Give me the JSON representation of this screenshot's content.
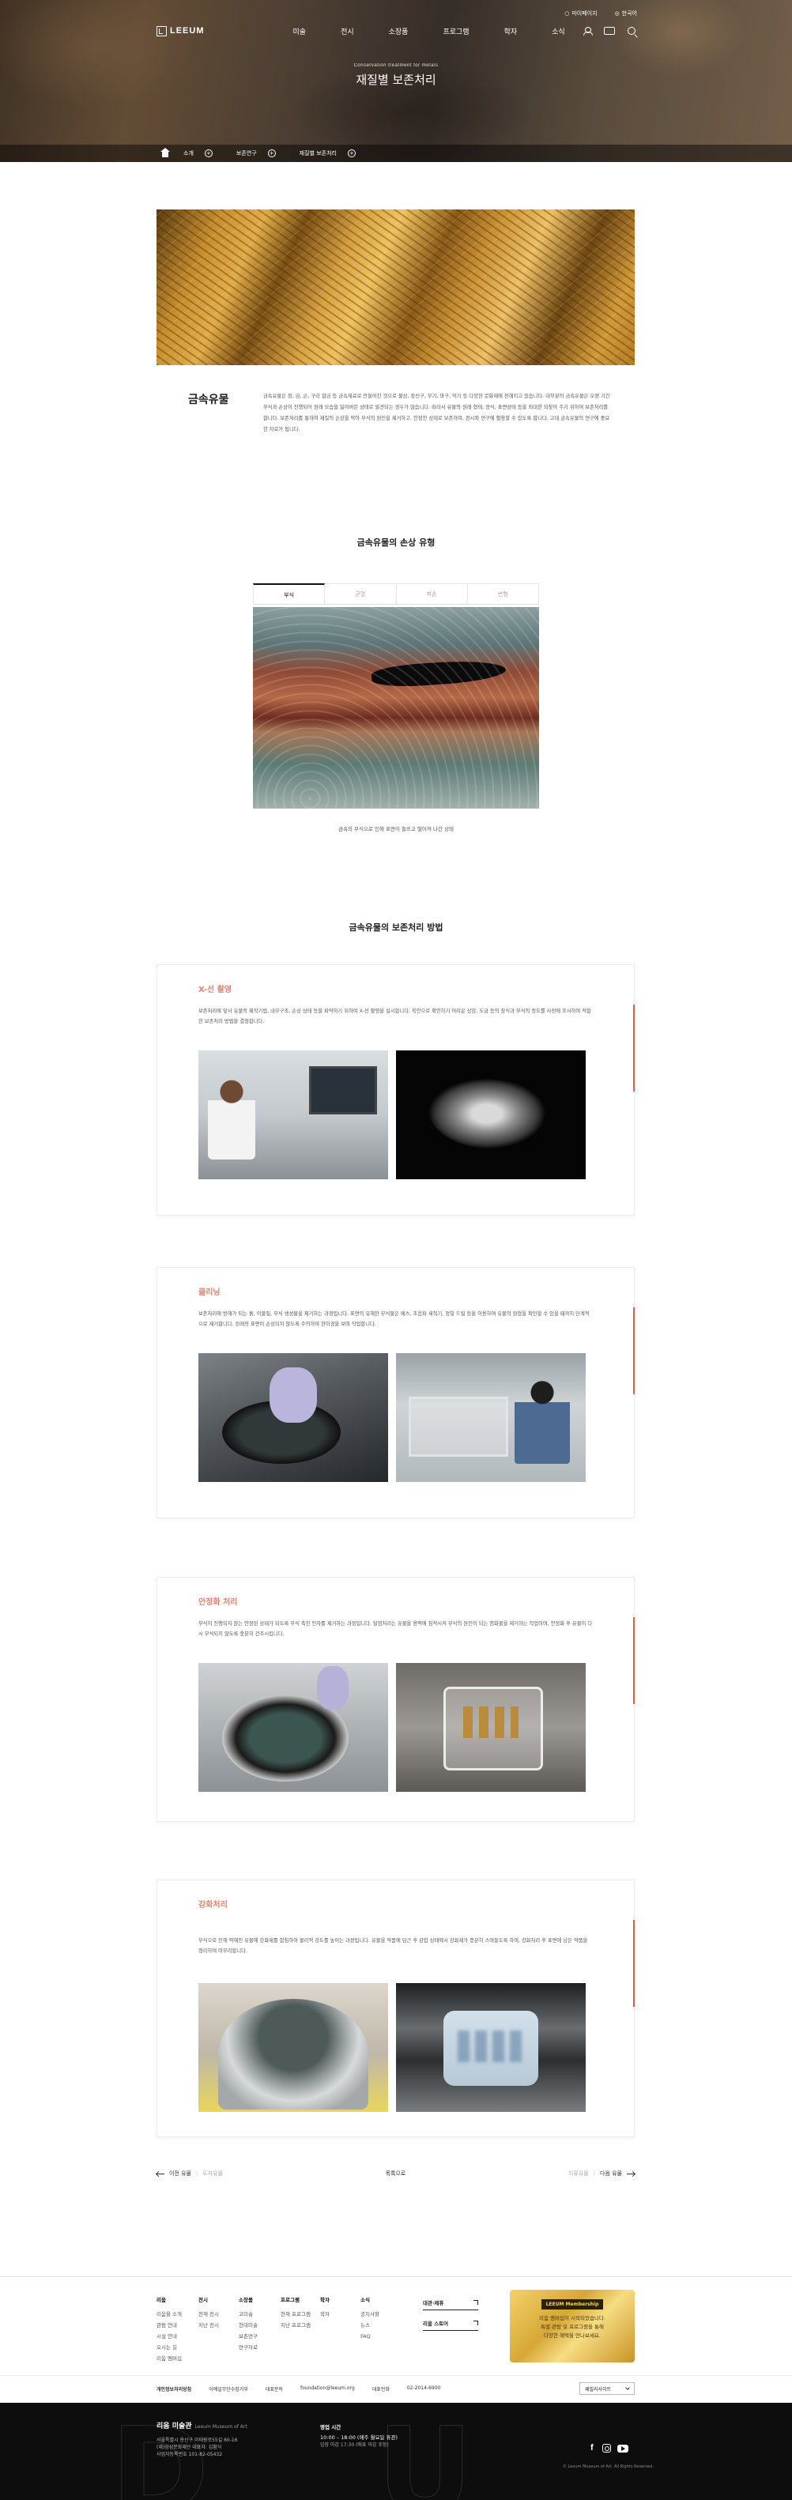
{
  "header": {
    "utility": {
      "login": "마이페이지",
      "lang": "한국어"
    },
    "logo": "LEEUM",
    "menu": [
      "미술",
      "전시",
      "소장품",
      "프로그램",
      "학자",
      "소식"
    ],
    "hero_subtitle": "Conservation treatment for metals",
    "hero_title": "재질별 보존처리",
    "breadcrumbs": [
      "소개",
      "보존연구",
      "재질별 보존처리"
    ]
  },
  "intro": {
    "title": "금속유물",
    "text": "금속유물은 청, 금, 은, 구리 합금 등 금속재료로 만들어진 것으로 불상, 장신구, 무기, 마구, 악기 등 다양한 문화재에 전해지고 있습니다. 대부분의 금속유물은 오랜 기간 부식과 손상이 진행되어 원래 모습을 잃어버린 상태로 발견되는 경우가 많습니다. 따라서 유물의 원래 형태, 장식, 표면상태 등을 최대한 되찾아 주기 위하여 보존처리를 합니다. 보존처리를 통하여 재질의 손상을 막아 부식의 원인을 제거하고, 안정한 상태로 보존하며, 전시와 연구에 활용할 수 있도록 합니다. 고대 금속유물의 연구에 중요한 자료가 됩니다."
  },
  "damage": {
    "title": "금속유물의 손상 유형",
    "tabs": [
      "부식",
      "균열",
      "파손",
      "변형"
    ],
    "caption": "금속의 부식으로 인해 표면이 들뜨고 떨어져 나간 상태"
  },
  "methods": {
    "title": "금속유물의 보존처리 방법",
    "steps": [
      {
        "heading": "X-선 촬영",
        "text": "보존처리에 앞서 유물의 제작기법, 내부구조, 손상 상태 등을 파악하기 위하여 X-선 촬영을 실시합니다. 육안으로 확인하기 어려운 상감, 도금 등의 장식과 부식의 정도를 사전에 조사하여 적합한 보존처리 방법을 결정합니다."
      },
      {
        "heading": "클리닝",
        "text": "보존처리에 방해가 되는 흙, 이물질, 부식 생성물을 제거하는 과정입니다. 표면의 유해한 부식물은 메스, 초음파 세척기, 정밀 드릴 등을 이용하여 유물의 원형을 확인할 수 있을 때까지 단계적으로 제거합니다. 원래의 표면이 손상되지 않도록 주의하며 현미경을 보며 작업합니다."
      },
      {
        "heading": "안정화 처리",
        "text": "부식이 진행되지 않는 안정된 상태가 되도록 부식 촉진 인자를 제거하는 과정입니다. 탈염처리는 유물을 용액에 침적시켜 부식의 원인이 되는 염화물을 제거하는 작업이며, 안정화 후 유물이 다시 부식되지 않도록 충분히 건조시킵니다."
      },
      {
        "heading": "강화처리",
        "text": "부식으로 인해 약해진 유물에 강화제를 함침하여 물리적 강도를 높이는 과정입니다. 유물을 약품에 담근 후 감압 상태에서 강화제가 충분히 스며들도록 하며, 강화처리 후 표면에 남은 약품을 정리하여 마무리합니다."
      }
    ]
  },
  "pager": {
    "prev": "이전 유물",
    "prev_title": "도자유물",
    "list": "목록으로",
    "next_title": "지류유물",
    "next": "다음 유물"
  },
  "footer": {
    "cols": [
      {
        "title": "리움",
        "items": [
          "리움을 소개",
          "관람 안내",
          "시설 안내",
          "오시는 길",
          "리움 멤버십"
        ]
      },
      {
        "title": "전시",
        "items": [
          "현재 전시",
          "지난 전시"
        ]
      },
      {
        "title": "소장품",
        "items": [
          "고미술",
          "현대미술",
          "보존연구",
          "연구자료"
        ]
      },
      {
        "title": "프로그램",
        "items": [
          "현재 프로그램",
          "지난 프로그램"
        ]
      },
      {
        "title": "학자",
        "items": [
          "학자"
        ]
      },
      {
        "title": "소식",
        "items": [
          "공지사항",
          "뉴스",
          "FAQ"
        ]
      }
    ],
    "buttons": [
      "대관·제휴",
      "리움 스토어"
    ],
    "promo": {
      "badge": "LEEUM Membership",
      "line1": "리움 멤버십이 시작되었습니다.",
      "line2": "특별 관람 및 프로그램을 통해",
      "line3": "다양한 혜택을 만나보세요."
    },
    "links": [
      "개인정보처리방침",
      "이메일무단수집거부",
      "대표문의",
      "foundation@leeum.org",
      "대표전화",
      "02-2014-6900"
    ],
    "family_site": "패밀리사이트",
    "org_name": "리움 미술관",
    "org_sub": "Leeum Museum of Art",
    "address": [
      "서울특별시 용산구 이태원로55길 60-16",
      "(재)삼성문화재단 대표자: 김황식",
      "사업자등록번호 101-82-05432"
    ],
    "hours_title": "영업 시간",
    "hours": "10:00 – 18:00 (매주 월요일 휴관)",
    "hours_note": "입장 마감 17:30 (매표 마감 포함)",
    "copyright": "© Leeum Museum of Art. All Rights Reserved."
  }
}
